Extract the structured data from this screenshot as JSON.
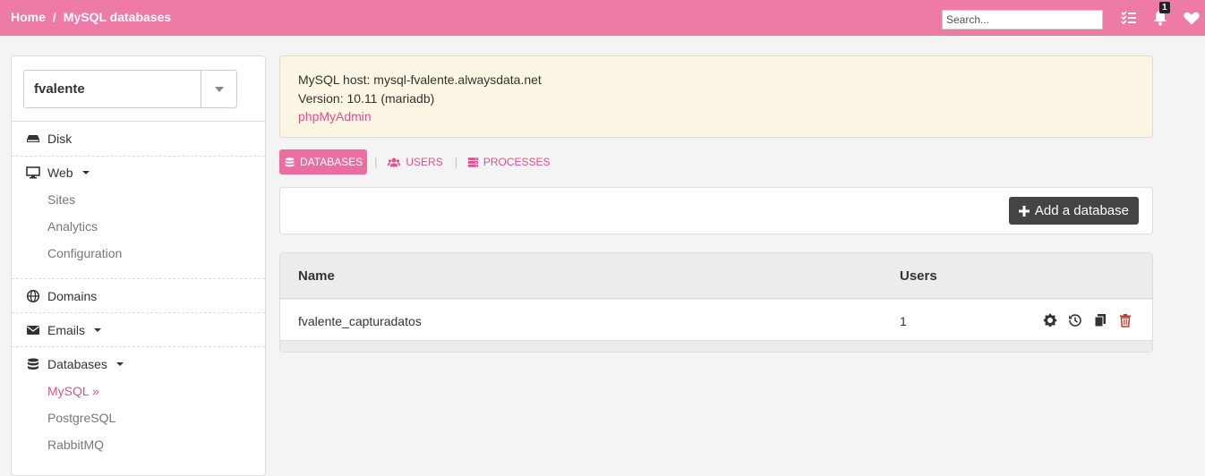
{
  "header": {
    "breadcrumb": [
      {
        "label": "Home"
      },
      {
        "label": "MySQL databases"
      }
    ],
    "separator": "/",
    "search_placeholder": "Search...",
    "notification_count": "1",
    "accent_color": "#ee7aa6"
  },
  "sidebar": {
    "account": "fvalente",
    "items": [
      {
        "label": "Disk",
        "icon": "hdd-icon"
      },
      {
        "label": "Web",
        "icon": "monitor-icon",
        "dropdown": true,
        "subitems": [
          "Sites",
          "Analytics",
          "Configuration"
        ]
      },
      {
        "label": "Domains",
        "icon": "globe-icon"
      },
      {
        "label": "Emails",
        "icon": "envelope-icon",
        "dropdown": true
      },
      {
        "label": "Databases",
        "icon": "database-icon",
        "dropdown": true,
        "subitems": [
          "MySQL »",
          "PostgreSQL",
          "RabbitMQ"
        ],
        "active_subitem": "MySQL »"
      }
    ]
  },
  "info": {
    "host_line": "MySQL host: mysql-fvalente.alwaysdata.net",
    "version_line": "Version: 10.11 (mariadb)",
    "link": "phpMyAdmin"
  },
  "tabs": [
    {
      "label": "DATABASES",
      "icon": "database-icon",
      "active": true
    },
    {
      "label": "USERS",
      "icon": "users-icon",
      "active": false
    },
    {
      "label": "PROCESSES",
      "icon": "server-icon",
      "active": false
    }
  ],
  "toolbar": {
    "add_label": "Add a database"
  },
  "table": {
    "columns": [
      "Name",
      "Users"
    ],
    "rows": [
      {
        "name": "fvalente_capturadatos",
        "users": "1",
        "actions": [
          "gear-icon",
          "history-icon",
          "copy-icon",
          "trash-icon"
        ]
      }
    ]
  }
}
